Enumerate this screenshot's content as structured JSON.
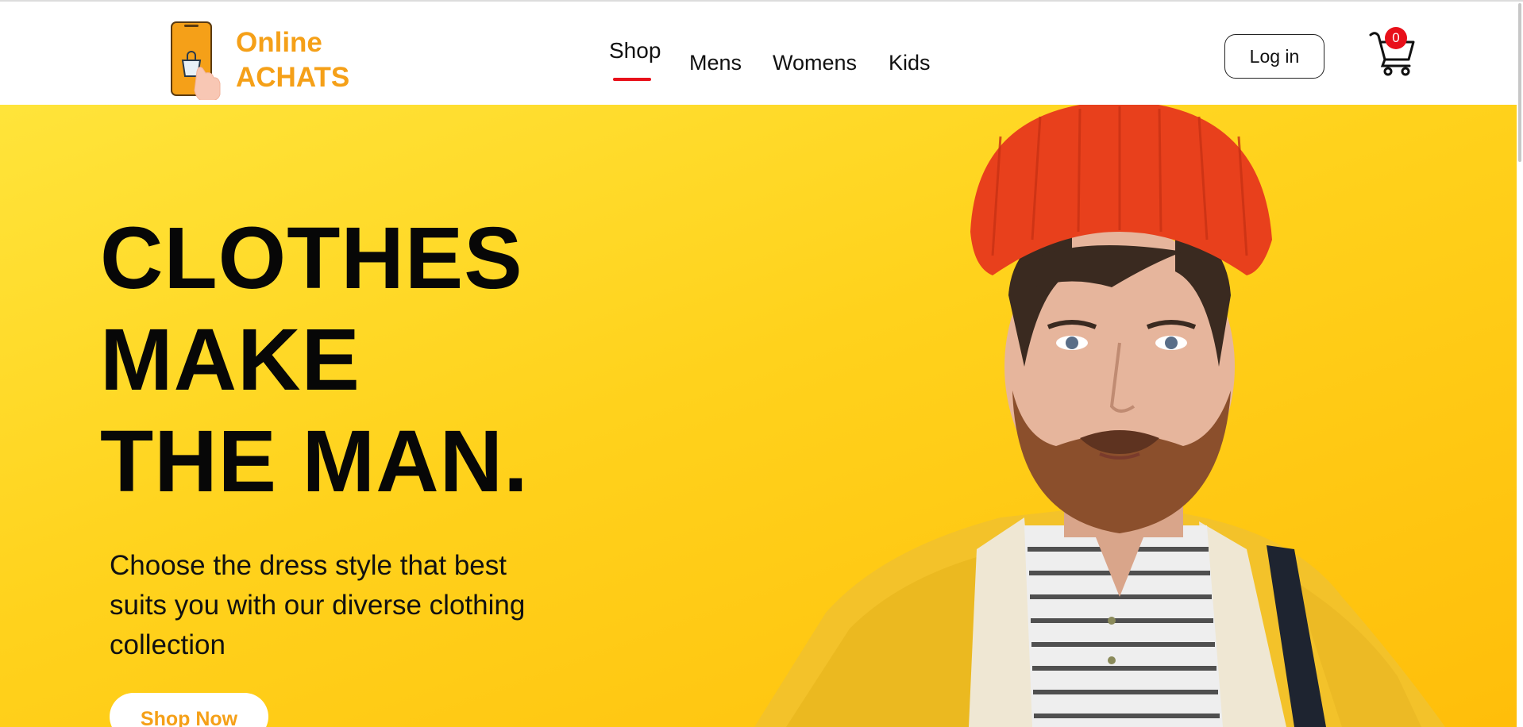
{
  "header": {
    "logo": {
      "line1": "Online",
      "line2": "ACHATS",
      "icon": "phone-shopping-bag-icon"
    },
    "nav": [
      {
        "label": "Shop",
        "active": true
      },
      {
        "label": "Mens",
        "active": false
      },
      {
        "label": "Womens",
        "active": false
      },
      {
        "label": "Kids",
        "active": false
      }
    ],
    "login_label": "Log in",
    "cart": {
      "icon": "cart-icon",
      "count": "0"
    }
  },
  "hero": {
    "headline": [
      "CLOTHES",
      "MAKE",
      "THE MAN."
    ],
    "subtext": "Choose the dress style that best suits you with our diverse clothing collection",
    "cta_label": "Shop Now"
  },
  "colors": {
    "brand_orange": "#f5a018",
    "accent_red": "#e8101a",
    "hero_yellow": "#ffd21c"
  }
}
